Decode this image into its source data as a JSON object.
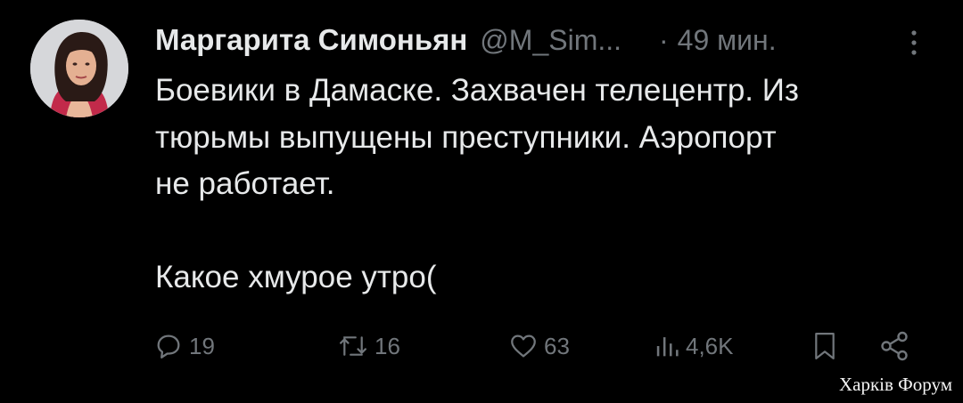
{
  "tweet": {
    "author": {
      "display_name": "Маргарита Симоньян",
      "handle": "@M_Sim...",
      "avatar_icon": "avatar-photo"
    },
    "separator": "·",
    "time": "49 мин.",
    "body_lines": [
      "Боевики в Дамаске. Захвачен телецентр. Из",
      "тюрьмы выпущены преступники. Аэропорт",
      "не работает.",
      "Какое хмурое утро("
    ],
    "actions": {
      "reply": {
        "icon": "reply-icon",
        "count": "19"
      },
      "retweet": {
        "icon": "retweet-icon",
        "count": "16"
      },
      "like": {
        "icon": "heart-icon",
        "count": "63"
      },
      "views": {
        "icon": "views-chart-icon",
        "count": "4,6K"
      },
      "bookmark": {
        "icon": "bookmark-icon"
      },
      "share": {
        "icon": "share-icon"
      }
    }
  },
  "watermark": "Харків Форум",
  "colors": {
    "background": "#000000",
    "text_primary": "#e7e9ea",
    "text_secondary": "#71767b"
  }
}
